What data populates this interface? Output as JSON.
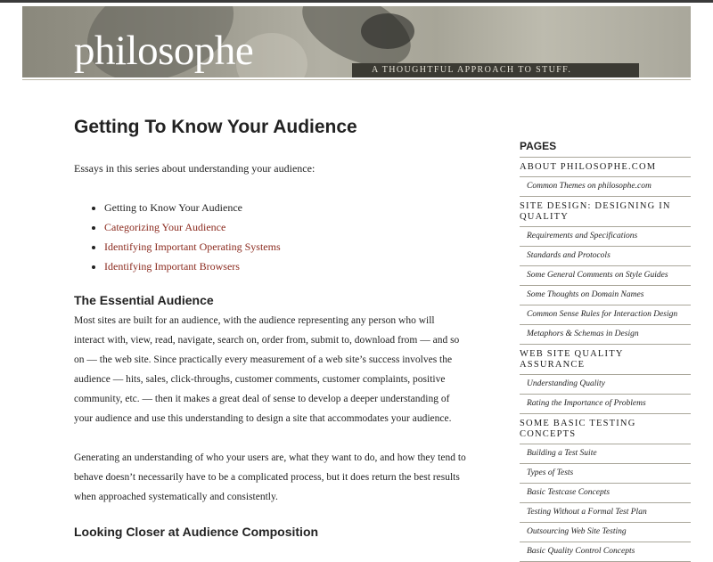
{
  "header": {
    "logo": "philosophe",
    "tagline": "A THOUGHTFUL APPROACH TO STUFF."
  },
  "main": {
    "title": "Getting To Know Your Audience",
    "intro": "Essays in this series about understanding your audience:",
    "essays": [
      {
        "label": "Getting to Know Your Audience",
        "current": true
      },
      {
        "label": "Categorizing Your Audience",
        "current": false
      },
      {
        "label": "Identifying Important Operating Systems",
        "current": false
      },
      {
        "label": "Identifying Important Browsers",
        "current": false
      }
    ],
    "section1_heading": "The Essential Audience",
    "paragraph1": "Most sites are built for an audience, with the audience representing any person who will interact with, view, read, navigate, search on, order from, submit to, download from — and so on — the web site. Since practically every measurement of a web site’s success involves the audience — hits, sales, click-throughs, customer comments, customer complaints, positive community, etc. — then it makes a great deal of sense to develop a deeper understanding of your audience and use this understanding to design a site that accommodates your audience.",
    "paragraph2": "Generating an understanding of who your users are, what they want to do, and how they tend to behave doesn’t necessarily have to be a complicated process, but it does return the best results when approached systematically and consistently.",
    "section2_heading": "Looking Closer at Audience Composition"
  },
  "sidebar": {
    "title": "PAGES",
    "items": [
      {
        "type": "cat",
        "label": "About philosophe.com"
      },
      {
        "type": "sub",
        "label": "Common Themes on philosophe.com"
      },
      {
        "type": "cat",
        "label": "Site Design: Designing in Quality"
      },
      {
        "type": "sub",
        "label": "Requirements and Specifications"
      },
      {
        "type": "sub",
        "label": "Standards and Protocols"
      },
      {
        "type": "sub",
        "label": "Some General Comments on Style Guides"
      },
      {
        "type": "sub",
        "label": "Some Thoughts on Domain Names"
      },
      {
        "type": "sub",
        "label": "Common Sense Rules for Interaction Design"
      },
      {
        "type": "sub",
        "label": "Metaphors & Schemas in Design"
      },
      {
        "type": "cat",
        "label": "Web Site Quality Assurance"
      },
      {
        "type": "sub",
        "label": "Understanding Quality"
      },
      {
        "type": "sub",
        "label": "Rating the Importance of Problems"
      },
      {
        "type": "cat",
        "label": "Some Basic Testing Concepts"
      },
      {
        "type": "sub",
        "label": "Building a Test Suite"
      },
      {
        "type": "sub",
        "label": "Types of Tests"
      },
      {
        "type": "sub",
        "label": "Basic Testcase Concepts"
      },
      {
        "type": "sub",
        "label": "Testing Without a Formal Test Plan"
      },
      {
        "type": "sub",
        "label": "Outsourcing Web Site Testing"
      },
      {
        "type": "sub",
        "label": "Basic Quality Control Concepts"
      }
    ]
  },
  "colors": {
    "link": "#8b2a1e",
    "header_bg": "#9b998d",
    "tagbar_bg": "#3b3a33",
    "rule": "#a9a69a"
  }
}
